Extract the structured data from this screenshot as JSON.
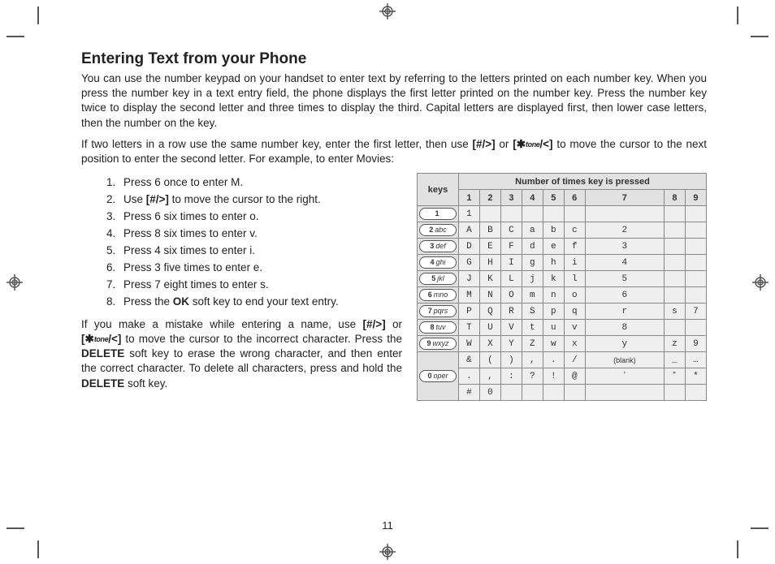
{
  "title": "Entering Text from your Phone",
  "para1": "You can use the number keypad on your handset to enter text by referring to the letters printed on each number key. When you press the number key in a text entry field, the phone displays the first letter printed on the number key. Press the number key twice to display the second letter and three times to display the third. Capital letters are displayed first, then lower case letters, then the number on the key.",
  "para2a": "If two letters in a row use the same number key, enter the first letter, then use ",
  "key_hash": "[#/>]",
  "para2b": " or ",
  "key_star_pre": "[",
  "key_star_sym": "✱",
  "tone": "tone",
  "key_star_post": "/<]",
  "para2c": " to move the cursor to the next position to enter the second letter. For example, to enter Movies:",
  "steps": {
    "s1": "Press 6 once to enter M.",
    "s2a": "Use ",
    "s2b": " to move the cursor to the right.",
    "s3": "Press 6 six times to enter o.",
    "s4": "Press 8 six times to enter v.",
    "s5": "Press 4 six times to enter i.",
    "s6": "Press 3 five times to enter e.",
    "s7": "Press 7 eight times to enter s.",
    "s8a": "Press the ",
    "ok": "OK",
    "s8b": " soft key to end your text entry."
  },
  "para3a": "If you make a mistake while entering a name, use ",
  "para3b": " or ",
  "para3c": " to move the cursor to the incorrect character. Press the ",
  "delete": "DELETE",
  "para3d": " soft key to erase the wrong character, and then enter the correct character. To delete all characters, press and hold the ",
  "para3e": " soft key.",
  "table": {
    "header_span": "Number of times key is pressed",
    "keys_label": "keys",
    "cols": [
      "1",
      "2",
      "3",
      "4",
      "5",
      "6",
      "7",
      "8",
      "9"
    ],
    "keycaps": {
      "k1": {
        "n": "1",
        "t": ""
      },
      "k2": {
        "n": "2",
        "t": "abc"
      },
      "k3": {
        "n": "3",
        "t": "def"
      },
      "k4": {
        "n": "4",
        "t": "ghi"
      },
      "k5": {
        "n": "5",
        "t": "jkl"
      },
      "k6": {
        "n": "6",
        "t": "mno"
      },
      "k7": {
        "n": "7",
        "t": "pqrs"
      },
      "k8": {
        "n": "8",
        "t": "tuv"
      },
      "k9": {
        "n": "9",
        "t": "wxyz"
      },
      "k0": {
        "n": "0",
        "t": "oper"
      }
    },
    "rows": [
      [
        "1",
        "",
        "",
        "",
        "",
        "",
        "",
        "",
        ""
      ],
      [
        "A",
        "B",
        "C",
        "a",
        "b",
        "c",
        "2",
        "",
        ""
      ],
      [
        "D",
        "E",
        "F",
        "d",
        "e",
        "f",
        "3",
        "",
        ""
      ],
      [
        "G",
        "H",
        "I",
        "g",
        "h",
        "i",
        "4",
        "",
        ""
      ],
      [
        "J",
        "K",
        "L",
        "j",
        "k",
        "l",
        "5",
        "",
        ""
      ],
      [
        "M",
        "N",
        "O",
        "m",
        "n",
        "o",
        "6",
        "",
        ""
      ],
      [
        "P",
        "Q",
        "R",
        "S",
        "p",
        "q",
        "r",
        "s",
        "7"
      ],
      [
        "T",
        "U",
        "V",
        "t",
        "u",
        "v",
        "8",
        "",
        ""
      ],
      [
        "W",
        "X",
        "Y",
        "Z",
        "w",
        "x",
        "y",
        "z",
        "9"
      ],
      [
        "&",
        "(",
        ")",
        ",",
        ".",
        "/",
        "(blank)",
        "_",
        "…"
      ],
      [
        ".",
        ",",
        ":",
        "?",
        "!",
        "@",
        "ʼ",
        "ˮ",
        "*"
      ],
      [
        "#",
        "0",
        "",
        "",
        "",
        "",
        "",
        "",
        ""
      ]
    ]
  },
  "page": "11"
}
